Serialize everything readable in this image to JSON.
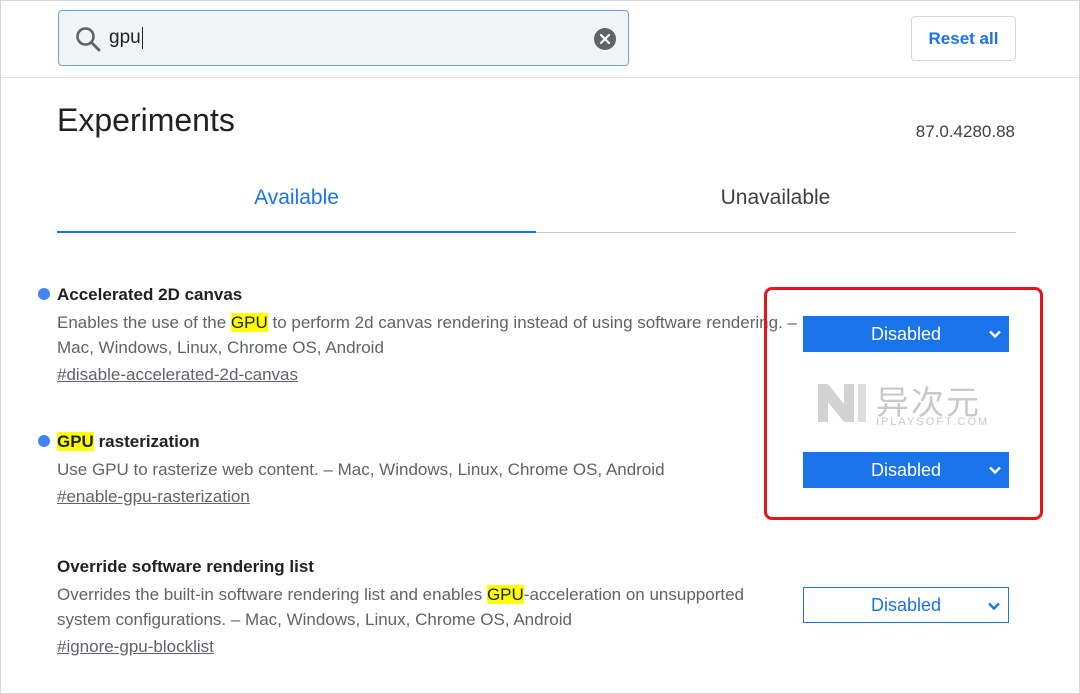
{
  "search": {
    "value": "gpu"
  },
  "header": {
    "reset_label": "Reset all"
  },
  "page": {
    "title": "Experiments",
    "version": "87.0.4280.88"
  },
  "tabs": [
    {
      "label": "Available",
      "active": true
    },
    {
      "label": "Unavailable",
      "active": false
    }
  ],
  "experiments": [
    {
      "name_parts": [
        "Accelerated 2D canvas"
      ],
      "desc_before": "Enables the use of the ",
      "desc_highlight": "GPU",
      "desc_after": " to perform 2d canvas rendering instead of using software rendering. – Mac, Windows, Linux, Chrome OS, Android",
      "link": "#disable-accelerated-2d-canvas",
      "select_value": "Disabled",
      "modified": true
    },
    {
      "name_highlight": "GPU",
      "name_after": " rasterization",
      "desc": "Use GPU to rasterize web content. – Mac, Windows, Linux, Chrome OS, Android",
      "link": "#enable-gpu-rasterization",
      "select_value": "Disabled",
      "modified": true
    },
    {
      "name": "Override software rendering list",
      "desc_before": "Overrides the built-in software rendering list and enables ",
      "desc_highlight": "GPU",
      "desc_after": "-acceleration on unsupported system configurations. – Mac, Windows, Linux, Chrome OS, Android",
      "link": "#ignore-gpu-blocklist",
      "select_value": "Disabled",
      "modified": false
    }
  ],
  "watermark": {
    "cn": "异次元",
    "en": "IPLAYSOFT.COM"
  },
  "colors": {
    "accent": "#1a73e8",
    "highlight": "#ffff00",
    "annotation": "#e8141c",
    "dot": "#4285f4"
  },
  "icons": {
    "search": "search-icon",
    "clear": "clear-icon",
    "chevron": "chevron-down-icon"
  }
}
